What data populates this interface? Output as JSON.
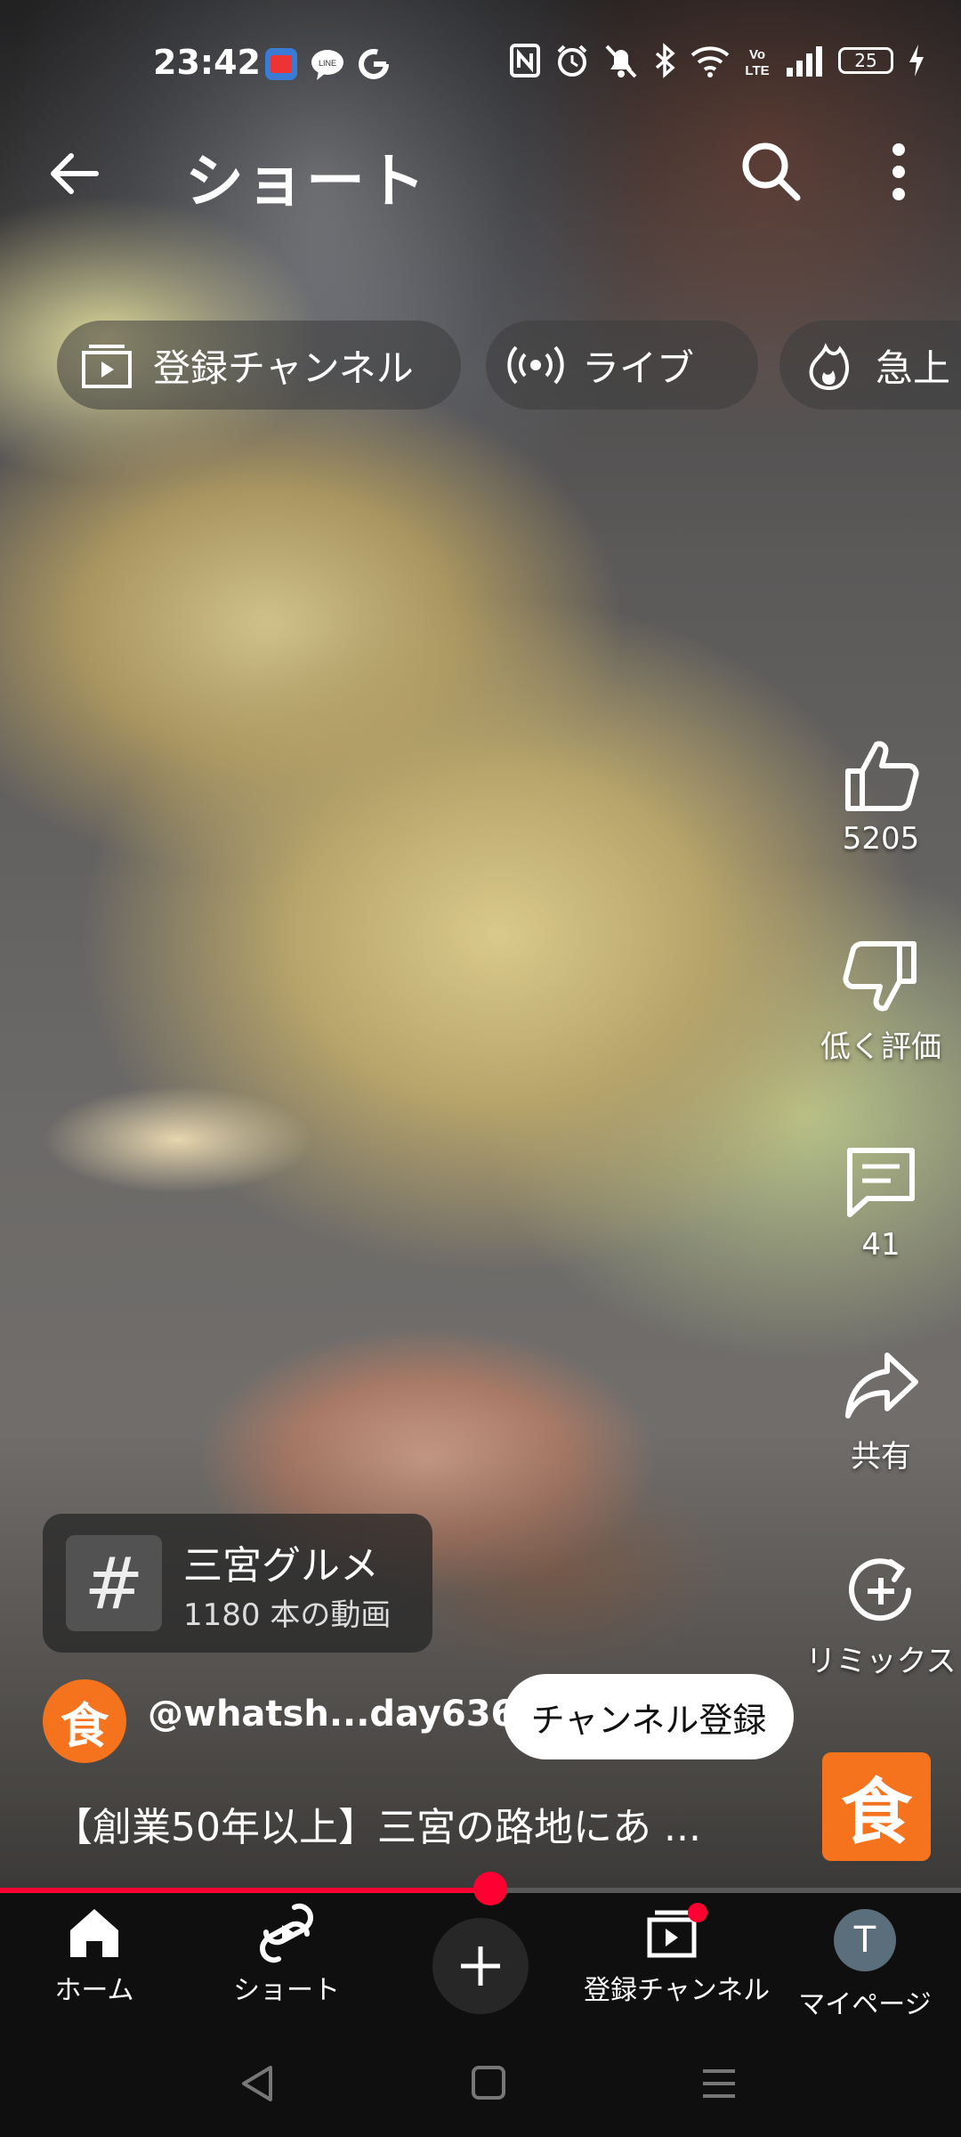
{
  "status_bar": {
    "time": "23:42",
    "battery": "25",
    "notification_icons": [
      "news-app-icon",
      "line-icon",
      "google-icon"
    ],
    "system_icons": [
      "nfc-icon",
      "alarm-icon",
      "mute-icon",
      "bluetooth-icon",
      "wifi-icon",
      "volte-icon",
      "signal-icon",
      "battery-icon",
      "charging-icon"
    ]
  },
  "appbar": {
    "title": "ショート"
  },
  "chips": [
    {
      "label": "登録チャンネル",
      "icon": "subscriptions-icon"
    },
    {
      "label": "ライブ",
      "icon": "live-icon"
    },
    {
      "label": "急上",
      "icon": "trending-icon"
    }
  ],
  "actions": {
    "like_count": "5205",
    "dislike_label": "低く評価",
    "comment_count": "41",
    "share_label": "共有",
    "remix_label": "リミックス"
  },
  "hashtag": {
    "symbol": "#",
    "title": "三宮グルメ",
    "subtitle": "1180 本の動画"
  },
  "channel": {
    "avatar_text": "食",
    "handle": "@whatsh...day6365",
    "subscribe_label": "チャンネル登録"
  },
  "video": {
    "title": "【創業50年以上】三宮の路地にあ ...",
    "logo_text": "食",
    "progress": 0.51
  },
  "bottom_nav": [
    {
      "label": "ホーム",
      "icon": "home-icon"
    },
    {
      "label": "ショート",
      "icon": "shorts-icon"
    },
    {
      "label": "",
      "icon": "create-icon"
    },
    {
      "label": "登録チャンネル",
      "icon": "subscriptions-icon"
    },
    {
      "label": "マイページ",
      "icon": "avatar",
      "avatar_letter": "T"
    }
  ],
  "colors": {
    "accent": "#ff0033",
    "channel_orange": "#f6731e"
  }
}
